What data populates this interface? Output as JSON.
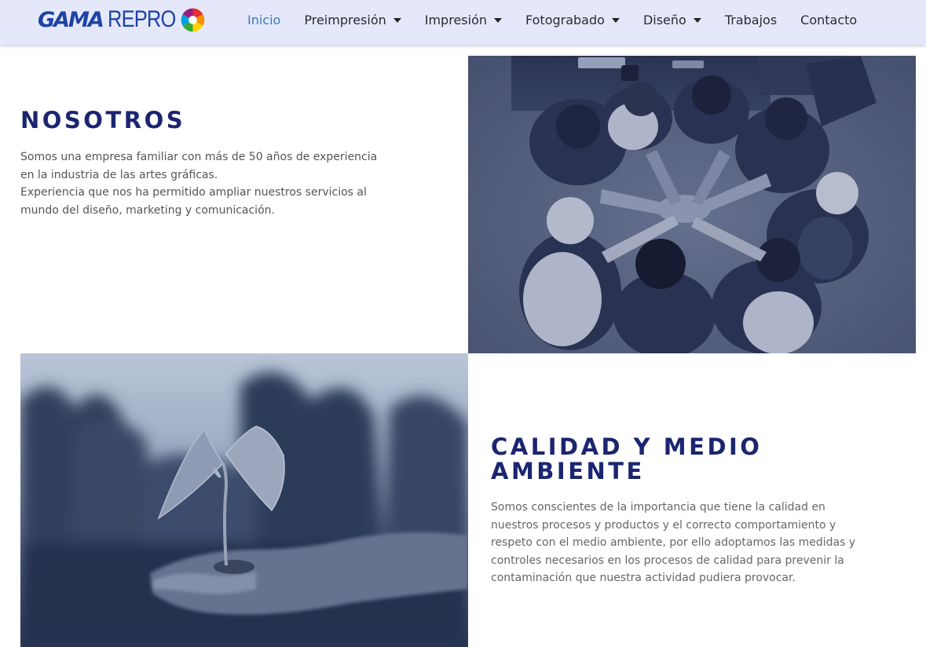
{
  "header": {
    "logo": {
      "brand_primary": "GAMA",
      "brand_secondary": "REPRO"
    },
    "nav": [
      {
        "label": "Inicio",
        "active": true,
        "dropdown": false
      },
      {
        "label": "Preimpresión",
        "active": false,
        "dropdown": true
      },
      {
        "label": "Impresión",
        "active": false,
        "dropdown": true
      },
      {
        "label": "Fotograbado",
        "active": false,
        "dropdown": true
      },
      {
        "label": "Diseño",
        "active": false,
        "dropdown": true
      },
      {
        "label": "Trabajos",
        "active": false,
        "dropdown": false
      },
      {
        "label": "Contacto",
        "active": false,
        "dropdown": false
      }
    ]
  },
  "about": {
    "title": "NOSOTROS",
    "lines": [
      "Somos una empresa familiar con más de 50 años de experiencia",
      "en la industria de las artes gráficas.",
      "Experiencia que nos ha permitido ampliar nuestros servicios al",
      "mundo del diseño, marketing y comunicación."
    ]
  },
  "quality": {
    "title_line1": "CALIDAD Y MEDIO",
    "title_line2": "AMBIENTE",
    "lines": [
      "Somos conscientes de la importancia que tiene la calidad en",
      "nuestros procesos y productos y el correcto comportamiento y",
      "respeto con el medio ambiente, por ello adoptamos las medidas y",
      "controles necesarios en los procesos de calidad para prevenir la",
      "contaminación que nuestra actividad pudiera provocar."
    ]
  },
  "colors": {
    "header_bg": "#e5e8fb",
    "brand_blue": "#1d43a6",
    "heading_navy": "#1b2570",
    "nav_active": "#3a78c0",
    "image_tint": "#1f2d4f"
  }
}
